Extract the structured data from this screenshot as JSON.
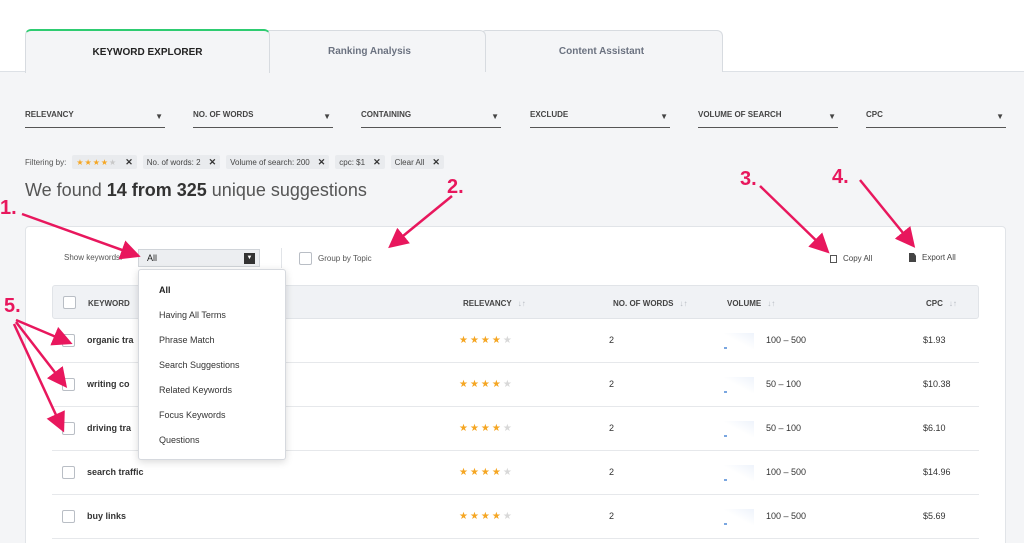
{
  "tabs": [
    {
      "label": "KEYWORD EXPLORER",
      "active": true
    },
    {
      "label": "Ranking Analysis",
      "active": false
    },
    {
      "label": "Content Assistant",
      "active": false
    }
  ],
  "filters": [
    {
      "label": "RELEVANCY"
    },
    {
      "label": "NO. OF WORDS"
    },
    {
      "label": "CONTAINING"
    },
    {
      "label": "EXCLUDE"
    },
    {
      "label": "VOLUME OF SEARCH"
    },
    {
      "label": "CPC"
    }
  ],
  "filtering": {
    "label": "Filtering by:",
    "chips": [
      "No. of words: 2",
      "Volume of search: 200",
      "cpc: $1",
      "Clear All"
    ],
    "star_chip_rating": 4
  },
  "summary": {
    "prefix": "We found ",
    "count": "14 from 325",
    "suffix": " unique suggestions"
  },
  "toolbar": {
    "show_label": "Show keywords:",
    "show_value": "All",
    "group_label": "Group by Topic",
    "copy_label": "Copy All",
    "export_label": "Export All"
  },
  "menu_options": [
    "All",
    "Having All Terms",
    "Phrase Match",
    "Search Suggestions",
    "Related Keywords",
    "Focus Keywords",
    "Questions"
  ],
  "columns": {
    "keyword": "KEYWORD",
    "relevancy": "RELEVANCY",
    "words": "NO. OF WORDS",
    "volume": "VOLUME",
    "cpc": "CPC"
  },
  "rows": [
    {
      "keyword": "organic tra",
      "rating": 4,
      "words": "2",
      "volume": "100 – 500",
      "cpc": "$1.93"
    },
    {
      "keyword": "writing co",
      "rating": 4,
      "words": "2",
      "volume": "50 – 100",
      "cpc": "$10.38"
    },
    {
      "keyword": "driving tra",
      "rating": 4,
      "words": "2",
      "volume": "50 – 100",
      "cpc": "$6.10"
    },
    {
      "keyword": "search traffic",
      "rating": 4,
      "words": "2",
      "volume": "100 – 500",
      "cpc": "$14.96"
    },
    {
      "keyword": "buy links",
      "rating": 4,
      "words": "2",
      "volume": "100 – 500",
      "cpc": "$5.69"
    }
  ],
  "annotations": [
    "1.",
    "2.",
    "3.",
    "4.",
    "5."
  ],
  "colors": {
    "accent": "#2ecc71",
    "star": "#f5a623",
    "annotation": "#e8175d"
  }
}
